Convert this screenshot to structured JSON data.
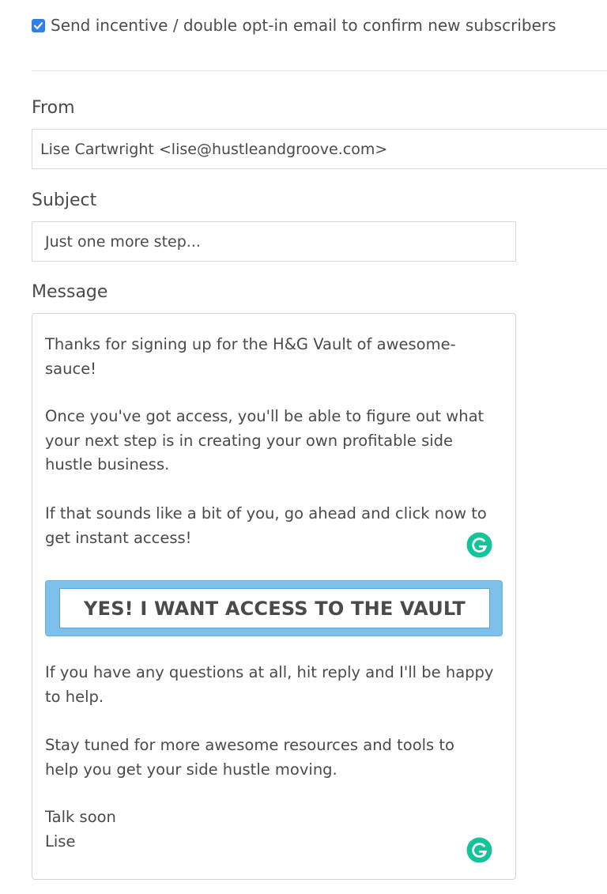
{
  "optin": {
    "checked": true,
    "label": "Send incentive / double opt-in email to confirm new subscribers"
  },
  "from": {
    "label": "From",
    "value": "Lise Cartwright <lise@hustleandgroove.com>"
  },
  "subject": {
    "label": "Subject",
    "value": "Just one more step..."
  },
  "message": {
    "label": "Message",
    "para1_line1": "Thanks for signing up for the H&G Vault of awesome-",
    "para1_line2": "sauce!",
    "para2_line1": "Once you've got access, you'll be able to figure out what",
    "para2_line2": "your next step is in creating your own profitable side",
    "para2_line3": "hustle business.",
    "para3_line1": "If that sounds like a bit of you, go ahead and click now to",
    "para3_line2": "get instant access!",
    "cta_label": "YES! I WANT ACCESS TO THE VAULT",
    "para4_line1": "If you have any questions at all, hit reply and I'll be happy",
    "para4_line2": "to help.",
    "para5_line1": "Stay tuned for more awesome resources and tools to",
    "para5_line2": "help you get your side hustle moving.",
    "signoff_line1": "Talk soon",
    "signoff_line2": "Lise"
  },
  "icons": {
    "checkbox": "checkmark-icon",
    "grammar": "grammarly-icon"
  },
  "colors": {
    "checkbox": "#2f7fe6",
    "cta_fill": "#7ec0ec",
    "cta_border": "#5aa3d8",
    "grammarly": "#15c39a"
  }
}
